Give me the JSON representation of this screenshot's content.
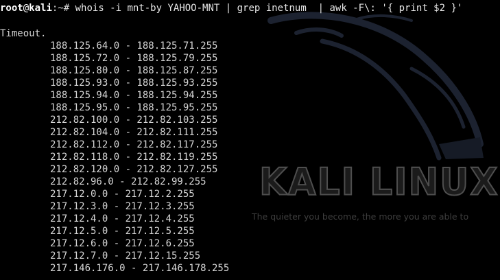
{
  "prompt": {
    "user": "root",
    "at": "@",
    "host": "kali",
    "path_and_symbol": ":~#",
    "command": " whois -i mnt-by YAHOO-MNT | grep inetnum  | awk -F\\: '{ print $2 }'"
  },
  "output": {
    "timeout": "Timeout.",
    "ranges": [
      "188.125.64.0 - 188.125.71.255",
      "188.125.72.0 - 188.125.79.255",
      "188.125.80.0 - 188.125.87.255",
      "188.125.93.0 - 188.125.93.255",
      "188.125.94.0 - 188.125.94.255",
      "188.125.95.0 - 188.125.95.255",
      "212.82.100.0 - 212.82.103.255",
      "212.82.104.0 - 212.82.111.255",
      "212.82.112.0 - 212.82.117.255",
      "212.82.118.0 - 212.82.119.255",
      "212.82.120.0 - 212.82.127.255",
      "212.82.96.0 - 212.82.99.255",
      "217.12.0.0 - 217.12.2.255",
      "217.12.3.0 - 217.12.3.255",
      "217.12.4.0 - 217.12.4.255",
      "217.12.5.0 - 217.12.5.255",
      "217.12.6.0 - 217.12.6.255",
      "217.12.7.0 - 217.12.15.255",
      "217.146.176.0 - 217.146.178.255"
    ]
  },
  "wallpaper": {
    "title": "KALI LINUX",
    "tagline": "The quieter you become, the more you are able to",
    "dragon_icon": "kali-dragon-icon"
  },
  "colors": {
    "background": "#000000",
    "text": "#d6d6d6",
    "prompt": "#ffffff",
    "wallpaper_accent": "#2a2f3a"
  }
}
